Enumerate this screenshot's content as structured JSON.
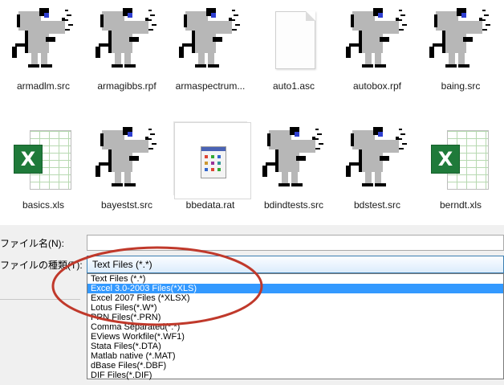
{
  "files": [
    {
      "name": "armadlm.src",
      "icon": "mouse-icon"
    },
    {
      "name": "armagibbs.rpf",
      "icon": "mouse-icon"
    },
    {
      "name": "armaspectrum...",
      "icon": "mouse-icon"
    },
    {
      "name": "auto1.asc",
      "icon": "blank-document-icon"
    },
    {
      "name": "autobox.rpf",
      "icon": "mouse-icon"
    },
    {
      "name": "baing.src",
      "icon": "mouse-icon"
    },
    {
      "name": "basics.xls",
      "icon": "excel-icon"
    },
    {
      "name": "bayestst.src",
      "icon": "mouse-icon"
    },
    {
      "name": "bbedata.rat",
      "icon": "rat-file-icon"
    },
    {
      "name": "bdindtests.src",
      "icon": "mouse-icon"
    },
    {
      "name": "bdstest.src",
      "icon": "mouse-icon"
    },
    {
      "name": "berndt.xls",
      "icon": "excel-icon"
    }
  ],
  "excel_badge_letter": "X",
  "dialog": {
    "filename_label": "ファイル名(N):",
    "filename_value": "",
    "filetype_label": "ファイルの種類(T):",
    "filetype_selected": "Text Files (*.*)",
    "options": [
      "Text Files (*.*)",
      "Excel 3.0-2003 Files(*XLS)",
      "Excel 2007 Files (*XLSX)",
      "Lotus Files(*.W*)",
      "PRN Files(*.PRN)",
      "Comma Separated(*.*)",
      "EViews Workfile(*.WF1)",
      "Stata Files(*.DTA)",
      "Matlab native (*.MAT)",
      "dBase Files(*.DBF)",
      "DIF Files(*.DIF)"
    ],
    "highlighted_index": 1
  },
  "colors": {
    "highlight": "#3399ff",
    "annotation_ellipse": "#c0392b",
    "excel_green": "#1f7a3a"
  }
}
